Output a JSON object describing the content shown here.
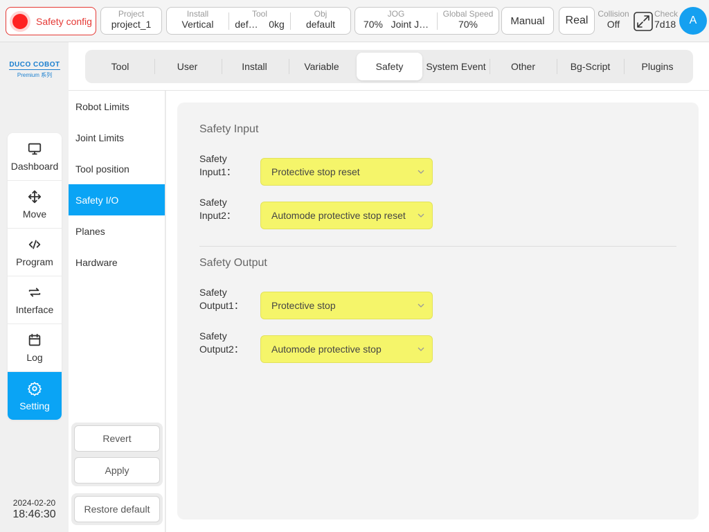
{
  "topbar": {
    "safety_label": "Safety config",
    "project": {
      "label": "Project",
      "value": "project_1"
    },
    "install": {
      "label": "Install",
      "value": "Vertical"
    },
    "tool": {
      "label": "Tool",
      "value_name": "def…",
      "value_weight": "0kg"
    },
    "obj": {
      "label": "Obj",
      "value": "default"
    },
    "jog": {
      "label": "JOG",
      "value_speed": "70%",
      "value_mode": "Joint J…"
    },
    "global_speed": {
      "label": "Global Speed",
      "value": "70%"
    },
    "mode_button": "Manual",
    "real_button": "Real",
    "collision": {
      "label": "Collision",
      "value": "Off"
    },
    "check": {
      "label": "Check",
      "value": "7d18"
    },
    "avatar": "A"
  },
  "logo": {
    "main": "DUCO COBOT",
    "sub": "Premium 系列"
  },
  "nav": {
    "items": [
      {
        "label": "Dashboard",
        "icon": "monitor-icon"
      },
      {
        "label": "Move",
        "icon": "move-arrows-icon"
      },
      {
        "label": "Program",
        "icon": "code-icon"
      },
      {
        "label": "Interface",
        "icon": "swap-icon"
      },
      {
        "label": "Log",
        "icon": "calendar-icon"
      },
      {
        "label": "Setting",
        "icon": "gear-icon"
      }
    ],
    "active": "Setting"
  },
  "datetime": {
    "date": "2024-02-20",
    "time": "18:46:30"
  },
  "tabs": {
    "items": [
      "Tool",
      "User",
      "Install",
      "Variable",
      "Safety",
      "System Event",
      "Other",
      "Bg-Script",
      "Plugins"
    ],
    "active": "Safety"
  },
  "submenu": {
    "items": [
      "Robot Limits",
      "Joint Limits",
      "Tool position",
      "Safety I/O",
      "Planes",
      "Hardware"
    ],
    "active": "Safety I/O",
    "revert": "Revert",
    "apply": "Apply",
    "restore": "Restore default"
  },
  "safety_io": {
    "input_title": "Safety Input",
    "inputs": [
      {
        "label_line1": "Safety",
        "label_line2": "Input1：",
        "value": "Protective stop reset"
      },
      {
        "label_line1": "Safety",
        "label_line2": "Input2：",
        "value": "Automode protective stop reset"
      }
    ],
    "output_title": "Safety Output",
    "outputs": [
      {
        "label_line1": "Safety",
        "label_line2": "Output1：",
        "value": "Protective stop"
      },
      {
        "label_line1": "Safety",
        "label_line2": "Output2：",
        "value": "Automode protective stop"
      }
    ]
  },
  "colors": {
    "accent": "#0aa4f5",
    "alert": "#e53935",
    "select_bg": "#f5f56a"
  }
}
